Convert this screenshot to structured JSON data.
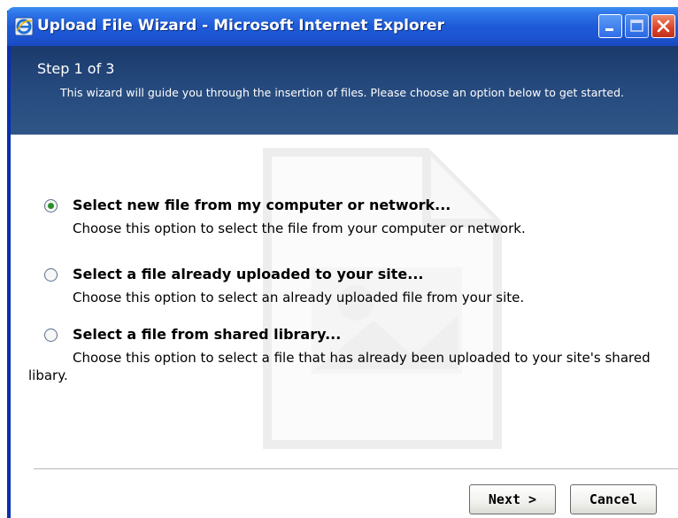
{
  "window": {
    "title": "Upload File Wizard - Microsoft Internet Explorer"
  },
  "header": {
    "step": "Step 1 of 3",
    "description": "This wizard will guide you through the insertion of files. Please choose an option below to get started."
  },
  "options": [
    {
      "label": "Select new file from my computer or network...",
      "description": "Choose this option to select the file from your computer or network.",
      "selected": true
    },
    {
      "label": "Select a file already uploaded to your site...",
      "description": "Choose this option to select an already uploaded file from your site.",
      "selected": false
    },
    {
      "label": "Select a file from shared library...",
      "description": "Choose this option to select a file that has already been uploaded to your site's shared libary.",
      "selected": false
    }
  ],
  "buttons": {
    "next": "Next >",
    "cancel": "Cancel"
  },
  "colors": {
    "title_bar": "#1e5ad8",
    "header_bg": "#25497d",
    "radio_selected": "#2a8f2a"
  },
  "icons": {
    "app": "internet-explorer-icon",
    "minimize": "minimize-icon",
    "maximize": "maximize-icon",
    "close": "close-icon",
    "watermark": "document-icon"
  }
}
